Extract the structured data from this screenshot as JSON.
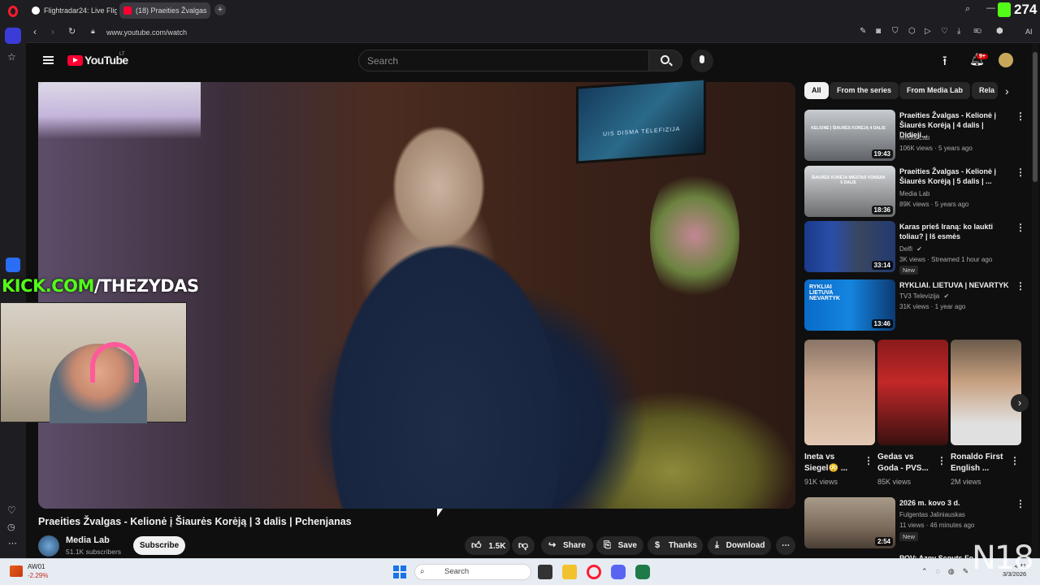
{
  "browser": {
    "tabs": [
      {
        "label": "Flightradar24: Live Flight T"
      },
      {
        "label": "(18) Praeities Žvalgas"
      }
    ],
    "url": "www.youtube.com/watch",
    "counter": "274",
    "ai_label": "AI"
  },
  "youtube": {
    "logo_text": "YouTube",
    "country": "LT",
    "search_placeholder": "Search",
    "notifications_badge": "9+"
  },
  "video": {
    "overlay_prefix": "KICK.COM",
    "overlay_suffix": "/THEZYDAS",
    "title": "Praeities Žvalgas - Kelionė į Šiaurės Korėją | 3 dalis | Pchenjanas",
    "channel": "Media Lab",
    "subscribers": "51.1K subscribers",
    "subscribe_label": "Subscribe",
    "likes": "1.5K",
    "share_label": "Share",
    "save_label": "Save",
    "thanks_label": "Thanks",
    "download_label": "Download",
    "tv_caption": "UIS DISMA TELEFIZIJA"
  },
  "chips": [
    "All",
    "From the series",
    "From Media Lab",
    "Rela"
  ],
  "recommendations": [
    {
      "title": "Praeities Žvalgas - Kelionė į Šiaurės Korėją | 4 dalis | Didieji...",
      "channel": "Media Lab",
      "meta": "106K views · 5 years ago",
      "duration": "19:43",
      "thumb_text": "KELIONĖ Į ŠIAURĖS KORĖJĄ 4 DALIS",
      "verified": false,
      "new": false
    },
    {
      "title": "Praeities Žvalgas - Kelionė į Šiaurės Korėją | 5 dalis | ...",
      "channel": "Media Lab",
      "meta": "89K views · 5 years ago",
      "duration": "18:36",
      "thumb_text": "ŠIAURĖS KORĖJA MIESTAS VONSAN 5 DALIS",
      "verified": false,
      "new": false
    },
    {
      "title": "Karas prieš Iraną: ko laukti toliau? | Iš esmės",
      "channel": "Delfi",
      "meta": "3K views · Streamed 1 hour ago",
      "duration": "33:14",
      "thumb_text": "",
      "verified": true,
      "new": true,
      "new_label": "New"
    },
    {
      "title": "RYKLIAI. LIETUVA | NEVARTYK",
      "channel": "TV3 Televizija",
      "meta": "31K views · 1 year ago",
      "duration": "13:46",
      "thumb_text": "RYKLIAI LIETUVA NEVARTYK",
      "verified": true,
      "new": false
    }
  ],
  "shorts": [
    {
      "title1": "Ineta vs",
      "title2": "Siegel😳 ...",
      "views": "91K views"
    },
    {
      "title1": "Gedas vs",
      "title2": "Goda - PVS...",
      "views": "85K views"
    },
    {
      "title1": "Ronaldo First",
      "title2": "English ...",
      "views": "2M views"
    }
  ],
  "bottom_rec": {
    "title": "2026 m. kovo 3 d.",
    "channel": "Fulgentas Jaliniauskas",
    "meta": "11 views · 46 minutes ago",
    "duration": "2:54",
    "new_label": "New"
  },
  "partial_rec_title": "POV: Azov Scouts Fo...",
  "taskbar": {
    "stock_name": "AW01",
    "stock_change": "-2.29%",
    "search_label": "Search",
    "time": "4:41",
    "date": "3/3/2026"
  },
  "watermark": "N18"
}
